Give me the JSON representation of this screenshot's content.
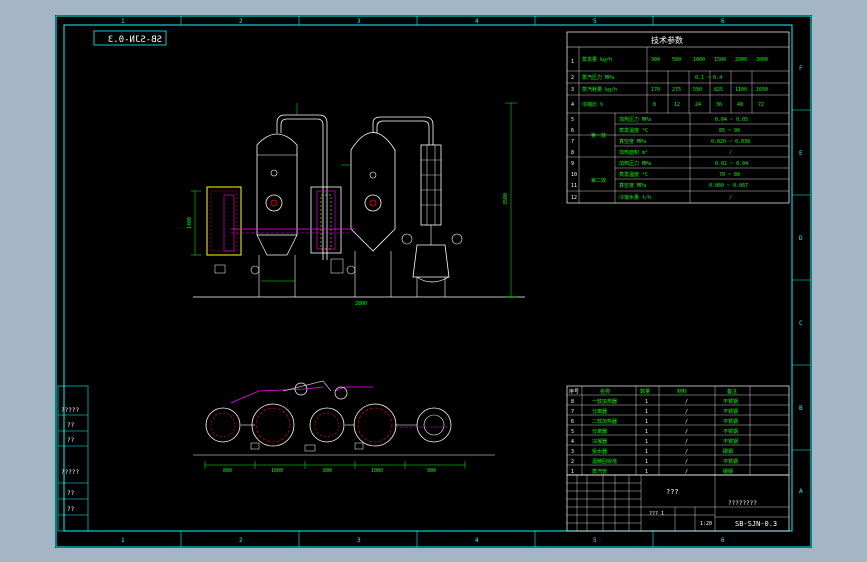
{
  "title_block": {
    "drawing_code_mirrored": "SB-SJN-0.3",
    "drawing_code": "SB-SJN-0.3",
    "title_placeholder": "???",
    "company_placeholder": "????????",
    "scale": "1:20",
    "sheet_note": "??? 1"
  },
  "tech_params": {
    "title": "技术参数",
    "rows": [
      {
        "no": "1",
        "name": "蒸发量 kg/h",
        "values": [
          "300",
          "500",
          "1000",
          "1500",
          "2000",
          "3000"
        ]
      },
      {
        "no": "2",
        "name": "蒸汽压力 MPa",
        "values": [
          "0.1 ~ 0.4"
        ]
      },
      {
        "no": "3",
        "name": "蒸汽耗量 kg/h",
        "values": [
          "170",
          "275",
          "550",
          "825",
          "1100",
          "1650"
        ]
      },
      {
        "no": "4",
        "name": "浓缩比 %",
        "values": [
          "8",
          "12",
          "24",
          "36",
          "48",
          "72"
        ]
      }
    ],
    "effect1_label": "第一效",
    "effect2_label": "第二效",
    "effect_rows": [
      {
        "no": "5",
        "name": "加热压力 MPa",
        "value": "0.04 ~ 0.05"
      },
      {
        "no": "6",
        "name": "蒸发温度 °C",
        "value": "85 ~ 90"
      },
      {
        "no": "7",
        "name": "真空度 MPa",
        "value": "0.020 ~ 0.030"
      },
      {
        "no": "8",
        "name": "加热面积 m²",
        "value": "/"
      },
      {
        "no": "9",
        "name": "加热压力 MPa",
        "value": "0.02 ~ 0.04"
      },
      {
        "no": "10",
        "name": "蒸发温度 °C",
        "value": "70 ~ 80"
      },
      {
        "no": "11",
        "name": "真空度 MPa",
        "value": "0.060 ~ 0.067"
      },
      {
        "no": "12",
        "name": "冷凝水量 t/h",
        "value": "/"
      }
    ]
  },
  "parts_list": {
    "header": [
      "序号",
      "名称",
      "数量",
      "材料",
      "备注"
    ],
    "rows": [
      [
        "8",
        "一效加热器",
        "1",
        "/",
        "不锈钢"
      ],
      [
        "7",
        "分离器",
        "1",
        "/",
        "不锈钢"
      ],
      [
        "6",
        "二效加热器",
        "1",
        "/",
        "不锈钢"
      ],
      [
        "5",
        "分离器",
        "1",
        "/",
        "不锈钢"
      ],
      [
        "4",
        "冷凝器",
        "1",
        "/",
        "不锈钢"
      ],
      [
        "3",
        "受水器",
        "1",
        "/",
        "碳钢"
      ],
      [
        "2",
        "酒精回收塔",
        "1",
        "/",
        "不锈钢"
      ],
      [
        "1",
        "蒸汽管",
        "1",
        "/",
        "碳钢"
      ]
    ]
  },
  "left_margin": {
    "labels": [
      "?????",
      "??",
      "??",
      "?????",
      "??",
      "??"
    ]
  },
  "dimension_labels": {
    "elevation_left": "1400",
    "elevation_right": "3500",
    "plan_bottom": [
      "800",
      "1000",
      "800",
      "1000",
      "900"
    ],
    "elevation_width": "2800"
  },
  "zone_numbers": {
    "top": [
      "1",
      "2",
      "3",
      "4",
      "5",
      "6"
    ],
    "side": [
      "A",
      "B",
      "C",
      "D",
      "E",
      "F"
    ]
  },
  "colors": {
    "line_main": "#ffffff",
    "line_frame": "#00ffff",
    "line_dim": "#00ff00",
    "line_pipe": "#ff00ff",
    "accent_yellow": "#ffff00",
    "accent_red": "#ff0000"
  }
}
